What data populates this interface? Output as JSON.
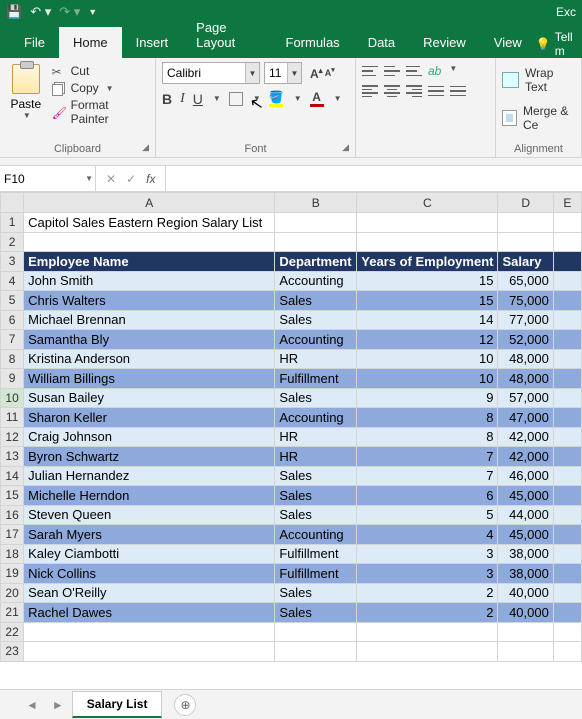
{
  "app_title": "Exc",
  "qat": {
    "save": "save",
    "undo": "undo",
    "redo": "redo"
  },
  "tabs": {
    "file": "File",
    "home": "Home",
    "insert": "Insert",
    "pagelayout": "Page Layout",
    "formulas": "Formulas",
    "data": "Data",
    "review": "Review",
    "view": "View",
    "tell": "Tell m"
  },
  "clipboard": {
    "paste": "Paste",
    "cut": "Cut",
    "copy": "Copy",
    "fmt": "Format Painter",
    "label": "Clipboard"
  },
  "font": {
    "name": "Calibri",
    "size": "11",
    "label": "Font"
  },
  "wrap": {
    "wrap_text": "Wrap Text",
    "merge": "Merge & Ce",
    "label": "Alignment"
  },
  "namebox": "F10",
  "sheet_tab": "Salary List",
  "cols": [
    "A",
    "B",
    "C",
    "D",
    "E"
  ],
  "title_cell": "Capitol Sales Eastern Region Salary List",
  "headers": {
    "a": "Employee Name",
    "b": "Department",
    "c": "Years of Employment",
    "d": "Salary"
  },
  "rows": [
    {
      "name": "John Smith",
      "dept": "Accounting",
      "years": "15",
      "salary": "65,000"
    },
    {
      "name": "Chris Walters",
      "dept": "Sales",
      "years": "15",
      "salary": "75,000"
    },
    {
      "name": "Michael Brennan",
      "dept": "Sales",
      "years": "14",
      "salary": "77,000"
    },
    {
      "name": "Samantha Bly",
      "dept": "Accounting",
      "years": "12",
      "salary": "52,000"
    },
    {
      "name": "Kristina Anderson",
      "dept": "HR",
      "years": "10",
      "salary": "48,000"
    },
    {
      "name": "William Billings",
      "dept": "Fulfillment",
      "years": "10",
      "salary": "48,000"
    },
    {
      "name": "Susan Bailey",
      "dept": "Sales",
      "years": "9",
      "salary": "57,000"
    },
    {
      "name": "Sharon Keller",
      "dept": "Accounting",
      "years": "8",
      "salary": "47,000"
    },
    {
      "name": "Craig Johnson",
      "dept": "HR",
      "years": "8",
      "salary": "42,000"
    },
    {
      "name": "Byron Schwartz",
      "dept": "HR",
      "years": "7",
      "salary": "42,000"
    },
    {
      "name": "Julian Hernandez",
      "dept": "Sales",
      "years": "7",
      "salary": "46,000"
    },
    {
      "name": "Michelle Herndon",
      "dept": "Sales",
      "years": "6",
      "salary": "45,000"
    },
    {
      "name": "Steven Queen",
      "dept": "Sales",
      "years": "5",
      "salary": "44,000"
    },
    {
      "name": "Sarah Myers",
      "dept": "Accounting",
      "years": "4",
      "salary": "45,000"
    },
    {
      "name": "Kaley Ciambotti",
      "dept": "Fulfillment",
      "years": "3",
      "salary": "38,000"
    },
    {
      "name": "Nick Collins",
      "dept": "Fulfillment",
      "years": "3",
      "salary": "38,000"
    },
    {
      "name": "Sean O'Reilly",
      "dept": "Sales",
      "years": "2",
      "salary": "40,000"
    },
    {
      "name": "Rachel Dawes",
      "dept": "Sales",
      "years": "2",
      "salary": "40,000"
    }
  ]
}
